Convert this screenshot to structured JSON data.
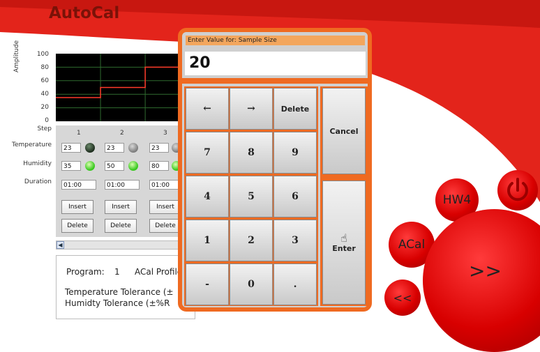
{
  "app": {
    "title": "AutoCal"
  },
  "chart_data": {
    "type": "line",
    "ylabel": "Amplitude",
    "yticks": [
      "100",
      "80",
      "60",
      "40",
      "20",
      "0"
    ],
    "ylim": [
      0,
      100
    ],
    "series": [
      {
        "values": [
          {
            "x": 0,
            "y": 35
          },
          {
            "x": 1,
            "y": 35
          },
          {
            "x": 1,
            "y": 50
          },
          {
            "x": 2,
            "y": 50
          },
          {
            "x": 2,
            "y": 80
          },
          {
            "x": 3,
            "y": 80
          }
        ]
      }
    ],
    "xlim": [
      0,
      3.2
    ],
    "grid": true
  },
  "grid": {
    "row_labels": {
      "step": "Step",
      "temperature": "Temperature",
      "humidity": "Humidity",
      "duration": "Duration"
    },
    "steps": [
      {
        "step": "1",
        "temperature": "23",
        "humidity": "35",
        "duration": "01:00",
        "insert": "Insert",
        "delete": "Delete"
      },
      {
        "step": "2",
        "temperature": "23",
        "humidity": "50",
        "duration": "01:00",
        "insert": "Insert",
        "delete": "Delete"
      },
      {
        "step": "3",
        "temperature": "23",
        "humidity": "80",
        "duration": "01:00",
        "insert": "Insert",
        "delete": "Delete"
      }
    ]
  },
  "info": {
    "program_label": "Program:",
    "program_value": "1",
    "profile_text": "ACal Profile",
    "temp_tolerance": "Temperature Tolerance (±",
    "hum_tolerance": "Humidty Tolerance (±%R"
  },
  "keypad": {
    "title": "Enter Value for: Sample Size",
    "value": "20",
    "left_arrow": "←",
    "right_arrow": "→",
    "delete": "Delete",
    "cancel": "Cancel",
    "enter": "Enter",
    "keys": [
      "7",
      "8",
      "9",
      "4",
      "5",
      "6",
      "1",
      "2",
      "3",
      "-",
      "0",
      "."
    ]
  },
  "nav": {
    "hw4": "HW4",
    "acal": "ACal",
    "back": "<<",
    "forward": ">>"
  },
  "colors": {
    "accent": "#ef6a21",
    "brand_red": "#d80000",
    "led_green": "#38c81e"
  }
}
